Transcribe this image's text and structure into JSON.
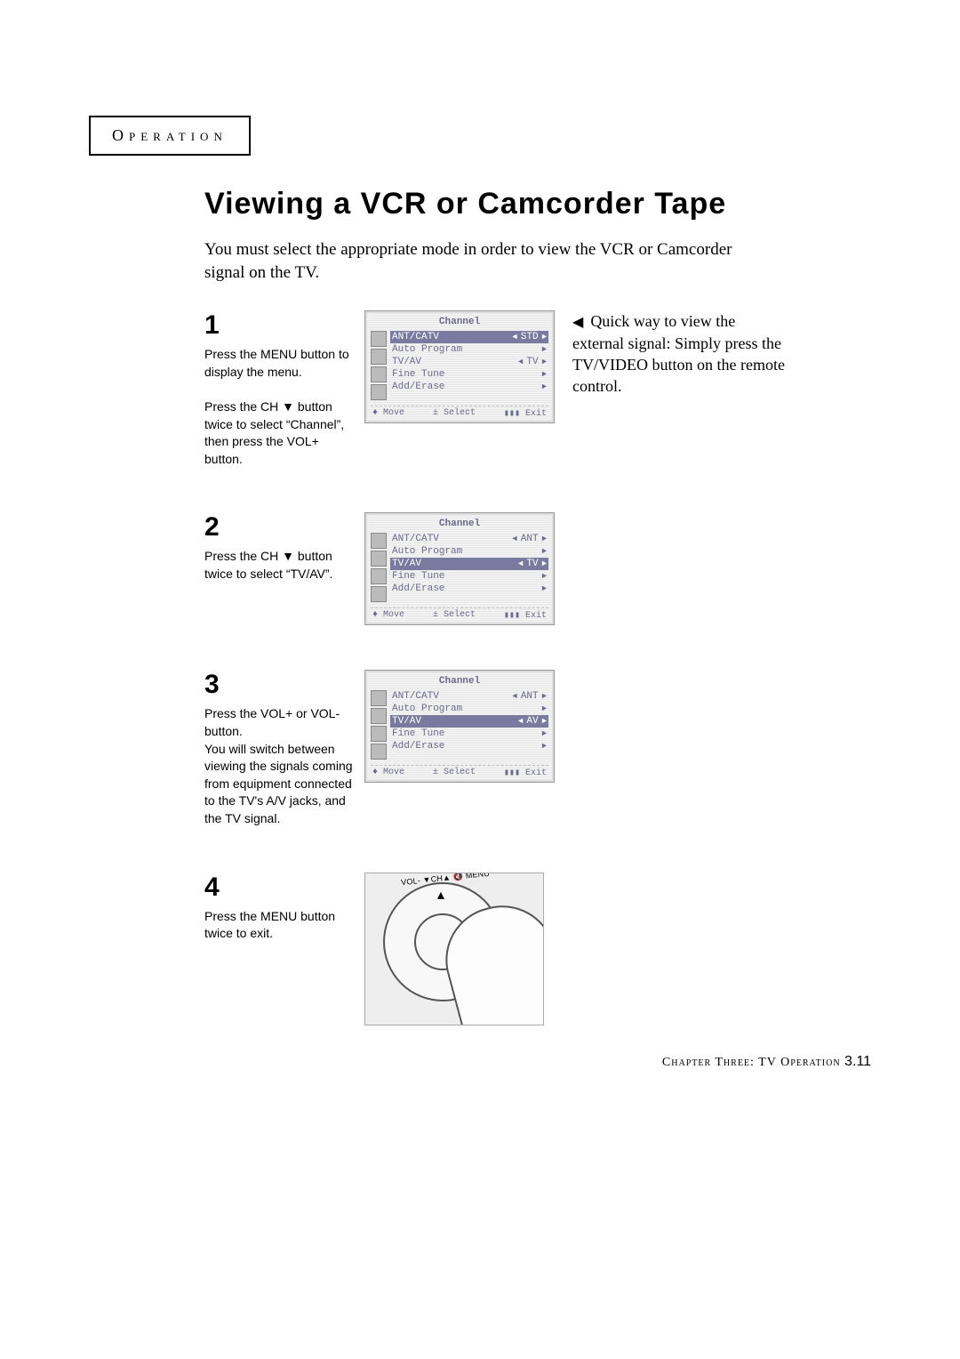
{
  "section_tab": "Operation",
  "title": "Viewing a VCR or Camcorder Tape",
  "intro": "You must select the appropriate mode in order to view the VCR or Camcorder signal on the TV.",
  "right_note": "Quick way to view the external signal: Simply press the TV/VIDEO button on the remote control.",
  "steps": [
    {
      "num": "1",
      "text_parts": [
        "Press the MENU button to display the menu.",
        "Press the CH ▼ button twice to select “Channel”, then press the VOL+ button."
      ],
      "osd": {
        "title": "Channel",
        "items": [
          {
            "label": "ANT/CATV",
            "val": "STD",
            "hl": true,
            "arrows": "both"
          },
          {
            "label": "Auto Program",
            "val": "",
            "arrows": "right"
          },
          {
            "label": "TV/AV",
            "val": "TV",
            "arrows": "both"
          },
          {
            "label": "Fine Tune",
            "val": "",
            "arrows": "right"
          },
          {
            "label": "Add/Erase",
            "val": "",
            "arrows": "right"
          }
        ],
        "footer": [
          "♦ Move",
          "± Select",
          "▮▮▮ Exit"
        ]
      }
    },
    {
      "num": "2",
      "text_parts": [
        "Press the CH ▼ button twice to select “TV/AV”."
      ],
      "osd": {
        "title": "Channel",
        "items": [
          {
            "label": "ANT/CATV",
            "val": "ANT",
            "arrows": "both"
          },
          {
            "label": "Auto Program",
            "val": "",
            "arrows": "right"
          },
          {
            "label": "TV/AV",
            "val": "TV",
            "hl": true,
            "arrows": "both"
          },
          {
            "label": "Fine Tune",
            "val": "",
            "arrows": "right"
          },
          {
            "label": "Add/Erase",
            "val": "",
            "arrows": "right"
          }
        ],
        "footer": [
          "♦ Move",
          "± Select",
          "▮▮▮ Exit"
        ]
      }
    },
    {
      "num": "3",
      "text_parts": [
        "Press the VOL+ or VOL- button.",
        "You will switch between viewing the signals coming from equipment connected to the TV's A/V jacks, and the TV signal."
      ],
      "osd": {
        "title": "Channel",
        "items": [
          {
            "label": "ANT/CATV",
            "val": "ANT",
            "arrows": "both"
          },
          {
            "label": "Auto Program",
            "val": "",
            "arrows": "right"
          },
          {
            "label": "TV/AV",
            "val": "AV",
            "hl": true,
            "arrows": "both"
          },
          {
            "label": "Fine Tune",
            "val": "",
            "arrows": "right"
          },
          {
            "label": "Add/Erase",
            "val": "",
            "arrows": "right"
          }
        ],
        "footer": [
          "♦ Move",
          "± Select",
          "▮▮▮ Exit"
        ]
      }
    },
    {
      "num": "4",
      "text_parts": [
        "Press the MENU button twice to exit."
      ],
      "remote_labels": "VOL-  ▼CH▲  🔇  MENU"
    }
  ],
  "footer": {
    "chapter": "Chapter Three: TV Operation",
    "page": "3.11"
  }
}
